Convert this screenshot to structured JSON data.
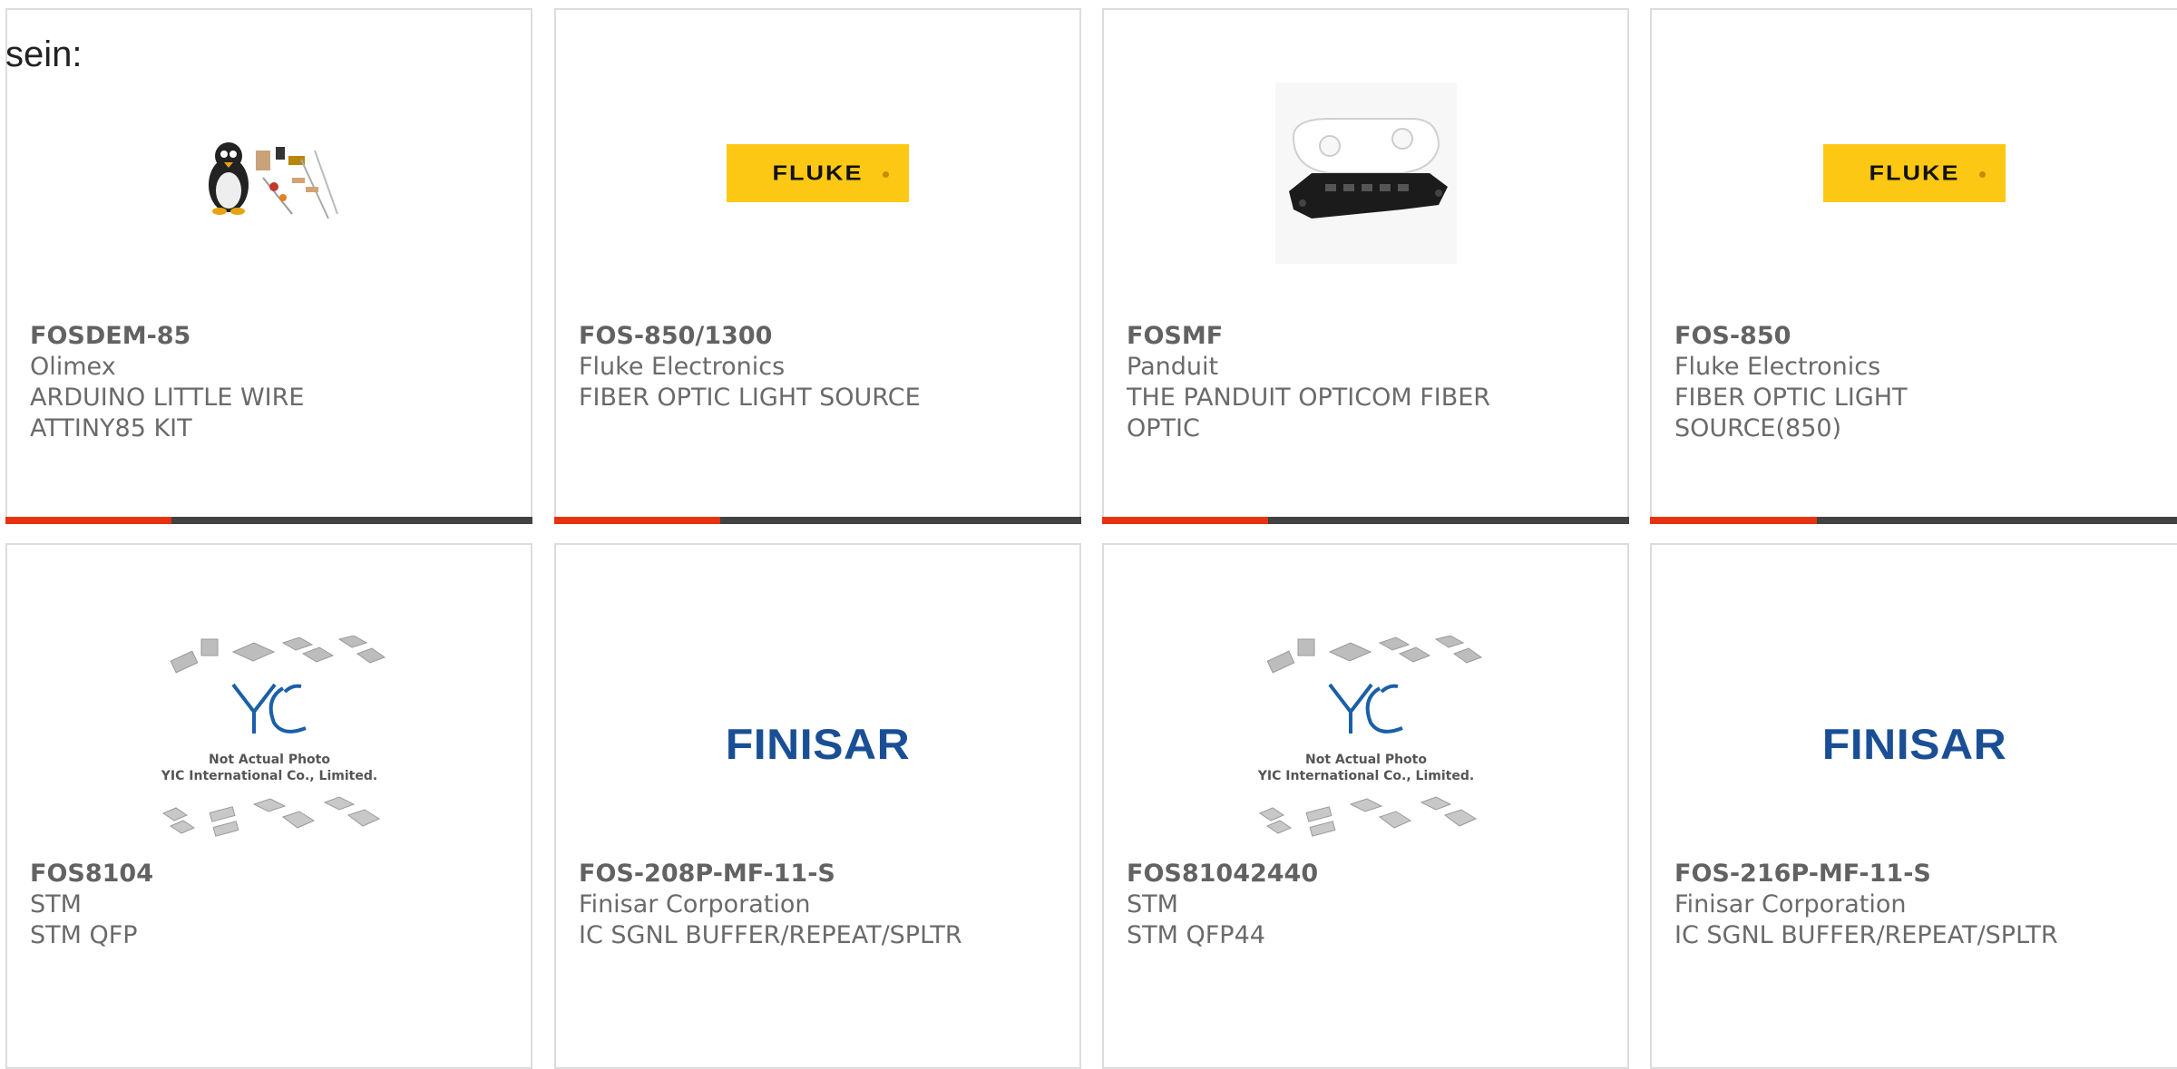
{
  "page": {
    "heading": "sein:"
  },
  "colors": {
    "accent": "#e5330e",
    "bar": "#424242",
    "fluke_yellow": "#fdc813",
    "finisar_blue": "#1a4f96"
  },
  "products": [
    {
      "part_number": "FOSDEM-85",
      "manufacturer": "Olimex",
      "description_lines": [
        "ARDUINO LITTLE WIRE",
        "ATTINY85 KIT"
      ],
      "image": "arduino-kit-photo"
    },
    {
      "part_number": "FOS-850/1300",
      "manufacturer": "Fluke Electronics",
      "description_lines": [
        "FIBER OPTIC LIGHT SOURCE"
      ],
      "image": "fluke-logo",
      "logo_text": "FLUKE"
    },
    {
      "part_number": "FOSMF",
      "manufacturer": "Panduit",
      "description_lines": [
        "THE PANDUIT OPTICOM FIBER",
        "OPTIC"
      ],
      "image": "panduit-bracket-photo"
    },
    {
      "part_number": "FOS-850",
      "manufacturer": "Fluke Electronics",
      "description_lines": [
        "FIBER OPTIC LIGHT",
        "SOURCE(850)"
      ],
      "image": "fluke-logo",
      "logo_text": "FLUKE"
    },
    {
      "part_number": "FOS8104",
      "manufacturer": "STM",
      "description_lines": [
        "STM QFP"
      ],
      "image": "yic-placeholder",
      "placeholder_lines": [
        "Not Actual Photo",
        "YIC International Co., Limited."
      ]
    },
    {
      "part_number": "FOS-208P-MF-11-S",
      "manufacturer": "Finisar Corporation",
      "description_lines": [
        "IC SGNL BUFFER/REPEAT/SPLTR"
      ],
      "image": "finisar-logo",
      "logo_text": "FINISAR"
    },
    {
      "part_number": "FOS81042440",
      "manufacturer": "STM",
      "description_lines": [
        "STM QFP44"
      ],
      "image": "yic-placeholder",
      "placeholder_lines": [
        "Not Actual Photo",
        "YIC International Co., Limited."
      ]
    },
    {
      "part_number": "FOS-216P-MF-11-S",
      "manufacturer": "Finisar Corporation",
      "description_lines": [
        "IC SGNL BUFFER/REPEAT/SPLTR"
      ],
      "image": "finisar-logo",
      "logo_text": "FINISAR"
    }
  ]
}
